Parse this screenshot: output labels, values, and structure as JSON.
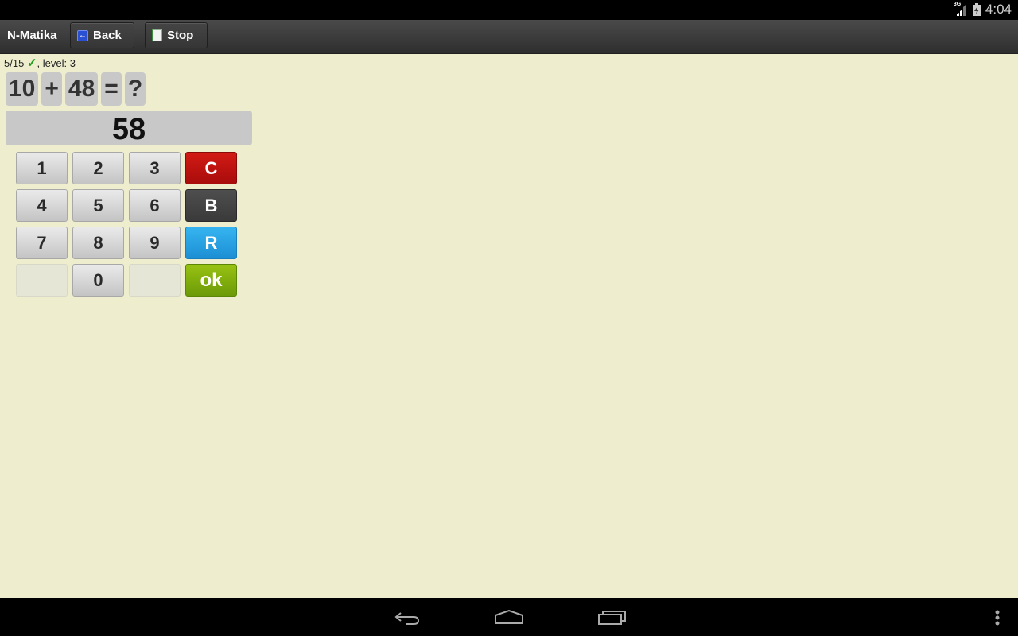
{
  "status_bar": {
    "network_label": "3G",
    "time": "4:04",
    "icons": [
      "signal-icon",
      "battery-charging-icon"
    ]
  },
  "action_bar": {
    "title": "N-Matika",
    "back_label": "Back",
    "stop_label": "Stop"
  },
  "progress": {
    "count": "5/15",
    "check_glyph": "✓",
    "level_text": ", level: 3"
  },
  "equation": {
    "operand1": "10",
    "operator": "+",
    "operand2": "48",
    "equals": "=",
    "unknown": "?"
  },
  "answer": "58",
  "keypad": {
    "keys": [
      "1",
      "2",
      "3",
      "C",
      "4",
      "5",
      "6",
      "B",
      "7",
      "8",
      "9",
      "R",
      "",
      "0",
      "",
      "ok"
    ]
  },
  "colors": {
    "background": "#eeeecf",
    "clear": "#c8140f",
    "backspace": "#444444",
    "reset": "#29a3e6",
    "ok": "#84b00e",
    "check": "#1a9a1a"
  },
  "nav_bar": {
    "buttons": [
      "back",
      "home",
      "recent-apps",
      "overflow-menu"
    ]
  }
}
